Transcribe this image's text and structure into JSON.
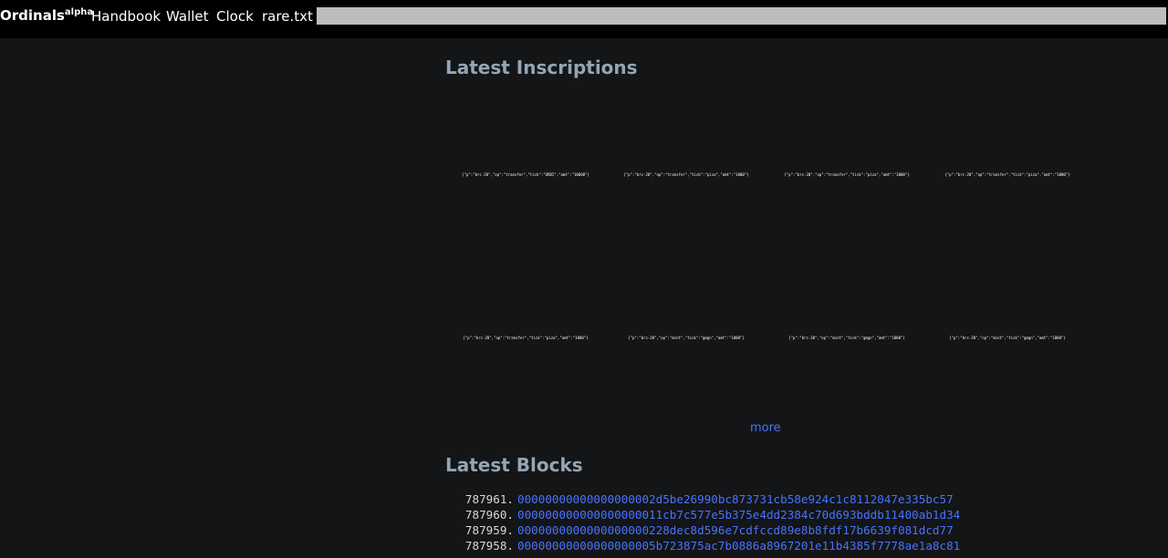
{
  "nav": {
    "brand": "Ordinals",
    "brand_sup": "alpha",
    "links": [
      "Handbook",
      "Wallet",
      "Clock",
      "rare.txt"
    ],
    "search_value": ""
  },
  "inscriptions": {
    "heading": "Latest Inscriptions",
    "items": [
      "{\"p\":\"brc-20\",\"op\":\"transfer\",\"tick\":\"ORDI\",\"amt\":\"10000\"}",
      "{\"p\":\"brc-20\",\"op\":\"transfer\",\"tick\":\"piza\",\"amt\":\"1000\"}",
      "{\"p\":\"brc-20\",\"op\":\"transfer\",\"tick\":\"piza\",\"amt\":\"1000\"}",
      "{\"p\":\"brc-20\",\"op\":\"transfer\",\"tick\":\"piza\",\"amt\":\"1000\"}",
      "{\"p\":\"brc-20\",\"op\":\"transfer\",\"tick\":\"piza\",\"amt\":\"1000\"}",
      "{\"p\":\"brc-20\",\"op\":\"mint\",\"tick\":\"gmgn\",\"amt\":\"1000\"}",
      "{\"p\":\"brc-20\",\"op\":\"mint\",\"tick\":\"gmgn\",\"amt\":\"1000\"}",
      "{\"p\":\"brc-20\",\"op\":\"mint\",\"tick\":\"gmgn\",\"amt\":\"1000\"}"
    ],
    "more_label": "more"
  },
  "blocks": {
    "heading": "Latest Blocks",
    "rows": [
      {
        "height": "787961.",
        "hash": "00000000000000000002d5be26990bc873731cb58e924c1c8112047e335bc57"
      },
      {
        "height": "787960.",
        "hash": "000000000000000000011cb7c577e5b375e4dd2384c70d693bddb11400ab1d34"
      },
      {
        "height": "787959.",
        "hash": "0000000000000000000228dec8d596e7cdfccd89e8b8fdf17b6639f081dcd77"
      },
      {
        "height": "787958.",
        "hash": "00000000000000000005b723875ac7b0886a8967201e11b4385f7778ae1a8c81"
      }
    ]
  },
  "colors": {
    "background": "#131516",
    "navbar": "#000000",
    "heading": "#95a5b3",
    "link": "#4a72ff"
  }
}
